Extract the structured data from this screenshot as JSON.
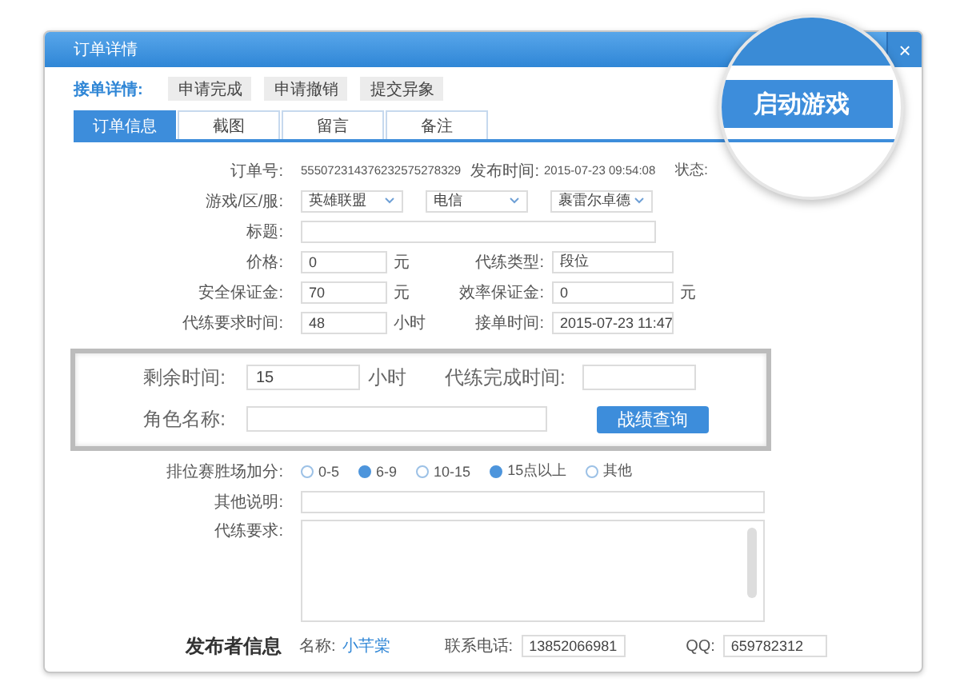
{
  "window": {
    "title": "订单详情",
    "close": "×"
  },
  "launch_button": "启动游戏",
  "actions": {
    "label": "接单详情:",
    "buttons": [
      "申请完成",
      "申请撤销",
      "提交异象"
    ]
  },
  "tabs": [
    {
      "label": "订单信息",
      "selected": true
    },
    {
      "label": "截图",
      "selected": false
    },
    {
      "label": "留言",
      "selected": false
    },
    {
      "label": "备注",
      "selected": false
    }
  ],
  "rows": [
    {
      "kind": "text",
      "cells": [
        {
          "label": "订单号:",
          "value": "555072314376232575278329"
        },
        {
          "label": "发布时间:",
          "value": "2015-07-23 09:54:08"
        },
        {
          "label": "状态:"
        }
      ]
    },
    {
      "kind": "selects",
      "label": "游戏/区/服:",
      "options": [
        "英雄联盟",
        "电信",
        "裹雷尔卓德"
      ]
    },
    {
      "kind": "wide",
      "label": "标题:"
    },
    {
      "kind": "pair",
      "cells": [
        {
          "label": "价格:",
          "value": "0",
          "unit": "元"
        },
        {
          "label": "代练类型:",
          "value": "段位"
        }
      ]
    },
    {
      "kind": "pair",
      "cells": [
        {
          "label": "安全保证金:",
          "value": "70",
          "unit": "元"
        },
        {
          "label": "效率保证金:",
          "value": "0",
          "unit": "元"
        }
      ]
    },
    {
      "kind": "pair",
      "cells": [
        {
          "label": "代练要求时间:",
          "value": "48",
          "unit": "小时"
        },
        {
          "label": "接单时间:",
          "value": "2015-07-23 11:47"
        }
      ]
    }
  ],
  "highlight": {
    "remaining": {
      "label": "剩余时间:",
      "value": "15",
      "unit": "小时"
    },
    "finish": {
      "label": "代练完成时间:"
    },
    "role": {
      "label": "角色名称:"
    },
    "query_button": "战绩查询"
  },
  "bonus": {
    "label": "排位赛胜场加分:",
    "options": [
      {
        "label": "0-5",
        "checked": false
      },
      {
        "label": "6-9",
        "checked": true
      },
      {
        "label": "10-15",
        "checked": false
      },
      {
        "label": "15点以上",
        "checked": true
      },
      {
        "label": "其他",
        "checked": false
      }
    ]
  },
  "other": {
    "label": "其他说明:"
  },
  "requirements": {
    "label": "代练要求:"
  },
  "publisher": {
    "title": "发布者信息",
    "name_label": "名称:",
    "name": "小芊棠",
    "phone_label": "联系电话:",
    "phone": "13852066981",
    "qq_label": "QQ:",
    "qq": "659782312"
  }
}
